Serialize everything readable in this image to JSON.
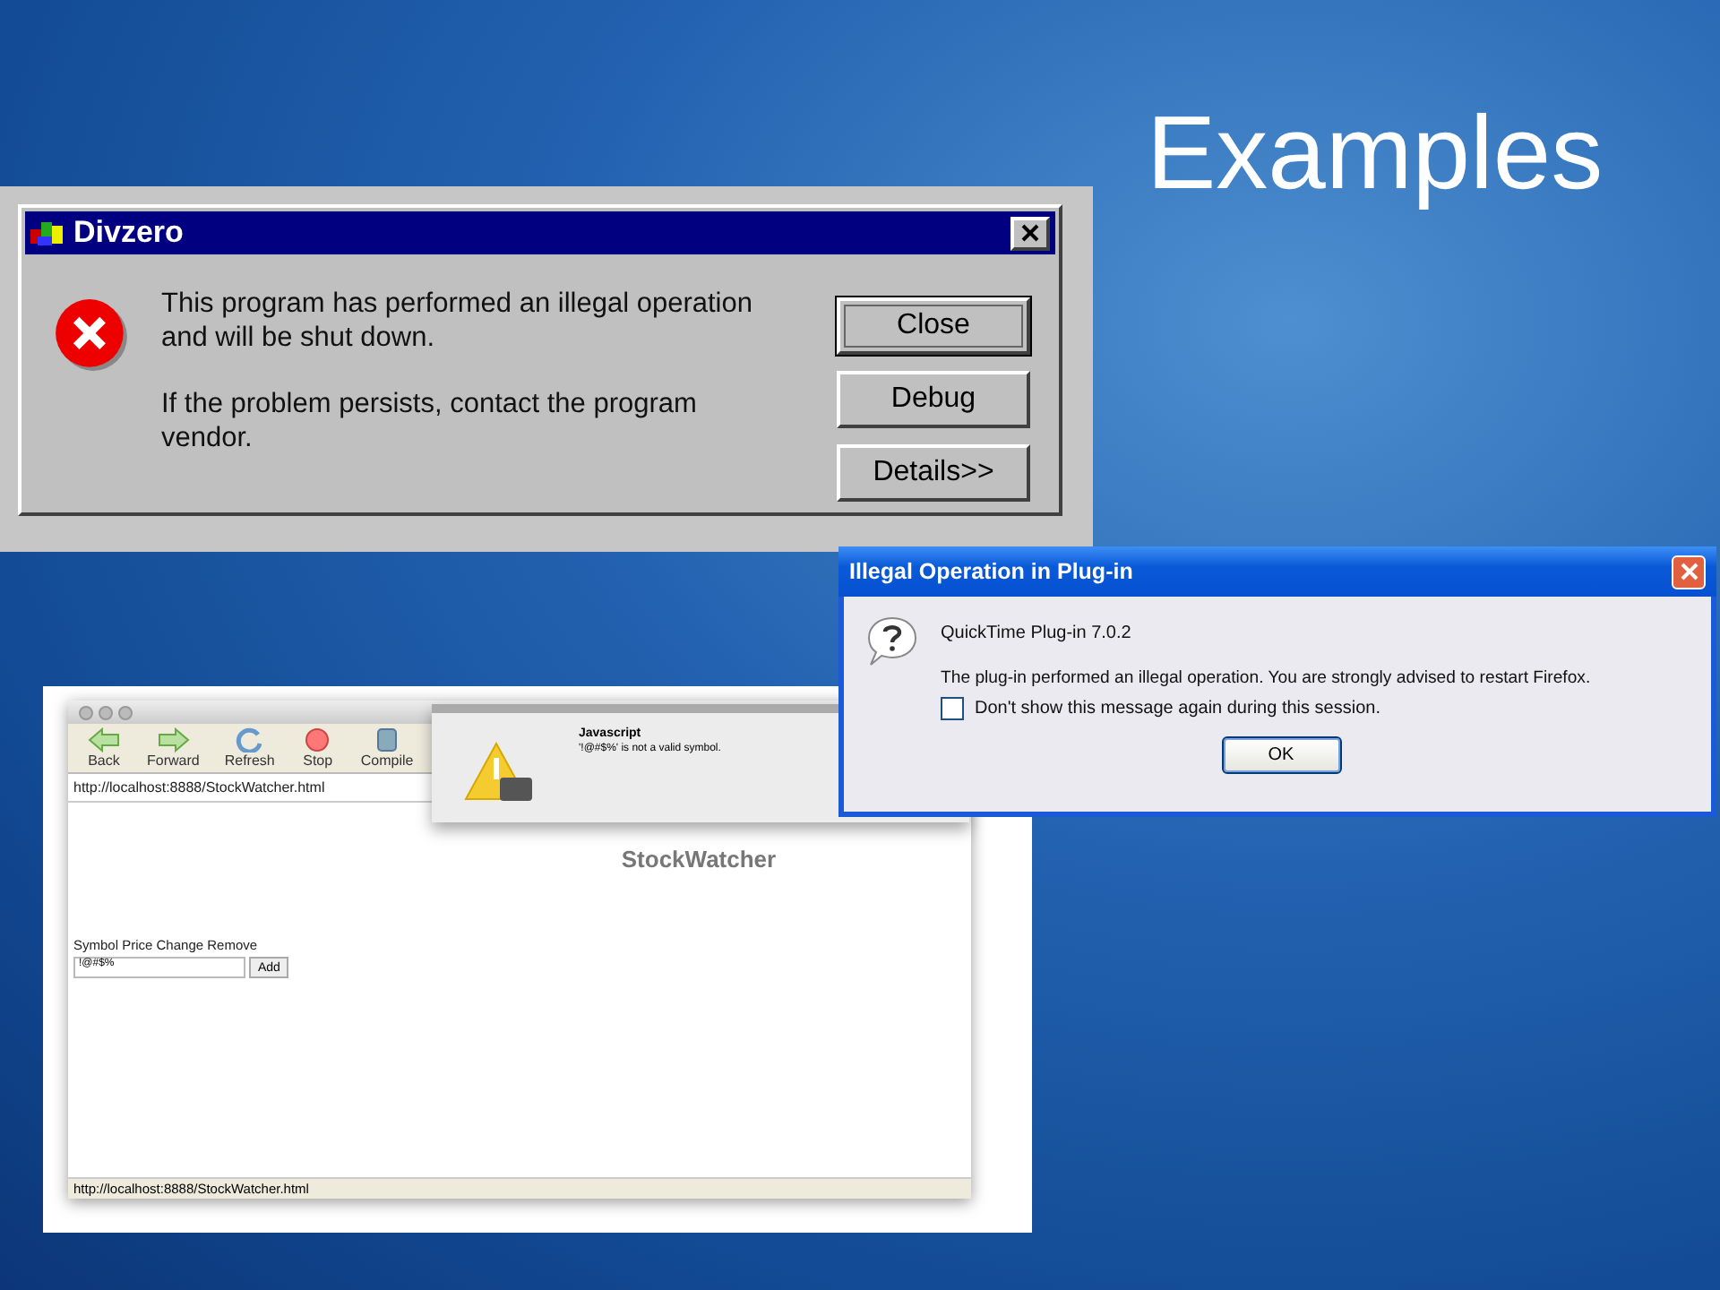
{
  "slide": {
    "title": "Examples"
  },
  "error_dialog": {
    "title": "Divzero",
    "messages": [
      "This program has performed an illegal operation and will be shut down.",
      "If the problem persists, contact the program vendor."
    ],
    "buttons": [
      {
        "label": "Close",
        "selected": true
      },
      {
        "label": "Debug",
        "selected": false
      },
      {
        "label": "Details>>",
        "selected": false
      }
    ]
  },
  "plugin_dialog": {
    "title": "Illegal Operation in Plug-in",
    "heading": "QuickTime Plug-in 7.0.2",
    "message": "The plug-in performed an illegal operation. You are strongly advised to restart Firefox.",
    "checkbox": {
      "label": "Don't show this message again during this session.",
      "checked": false
    },
    "button": "OK"
  },
  "browser": {
    "toolbar": [
      {
        "label": "Back",
        "kind": "back"
      },
      {
        "label": "Forward",
        "kind": "forward"
      },
      {
        "label": "Refresh",
        "kind": "refresh"
      },
      {
        "label": "Stop",
        "kind": "stop"
      },
      {
        "label": "Compile",
        "kind": "compile"
      }
    ],
    "address": "http://localhost:8888/StockWatcher.html",
    "page_title": "StockWatcher",
    "table_header": "Symbol Price Change Remove",
    "input_value": "!@#$%",
    "add_button": "Add",
    "status": "http://localhost:8888/StockWatcher.html"
  },
  "js_alert": {
    "title": "Javascript",
    "message": "'!@#$%' is not a valid symbol."
  }
}
